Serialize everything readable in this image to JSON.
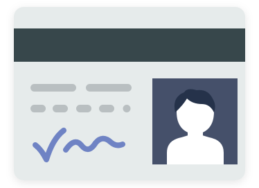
{
  "icon": {
    "name": "id-card-icon",
    "parts": [
      "magnetic-stripe",
      "text-lines",
      "signature",
      "photo"
    ]
  },
  "colors": {
    "card_body": "#e6ebeb",
    "card_shadow": "#d9dddd",
    "stripe": "#37474b",
    "text_lines": "#b9bfc1",
    "signature": "#6f83c4",
    "photo_bg": "#45506a",
    "silhouette_body": "#ffffff",
    "silhouette_hair": "#25324a"
  }
}
